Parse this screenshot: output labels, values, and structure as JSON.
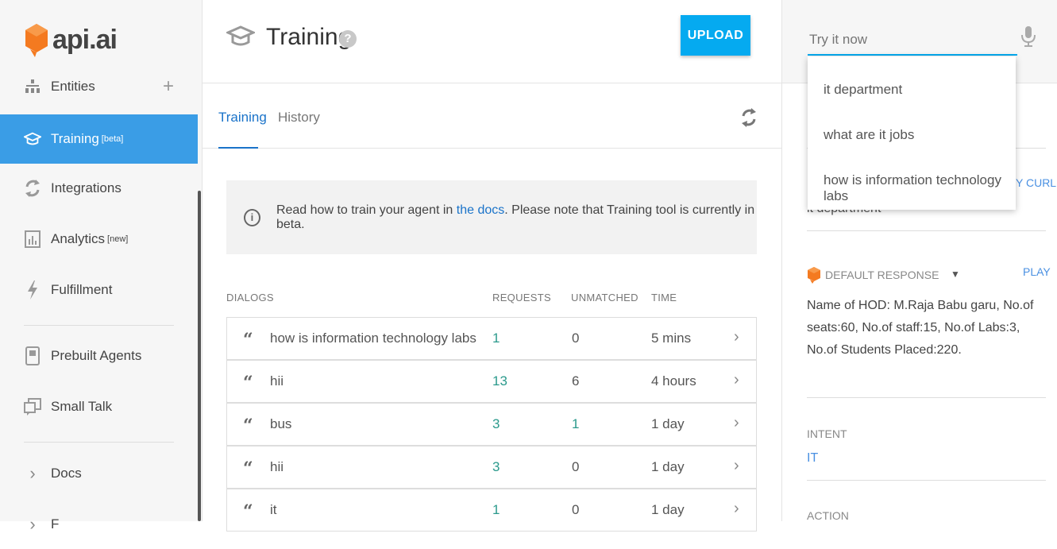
{
  "brand": {
    "name": "api.ai",
    "color": "#f47a20"
  },
  "sidebar": {
    "items": [
      {
        "label": "Entities",
        "icon": "entities-icon"
      },
      {
        "label": "Training",
        "sup": "[beta]",
        "icon": "graduation-cap-icon"
      },
      {
        "label": "Integrations",
        "icon": "integrations-icon"
      },
      {
        "label": "Analytics",
        "sup": "[new]",
        "icon": "analytics-icon"
      },
      {
        "label": "Fulfillment",
        "icon": "lightning-icon"
      },
      {
        "label": "Prebuilt Agents",
        "icon": "book-icon"
      },
      {
        "label": "Small Talk",
        "icon": "chat-icon"
      },
      {
        "label": "Docs",
        "icon": "chevron-right-icon"
      },
      {
        "label": "F",
        "icon": "chevron-right-icon"
      }
    ],
    "plus": "+",
    "active_color": "#3a9de6"
  },
  "header": {
    "title": "Training",
    "help": "?",
    "upload_label": "UPLOAD"
  },
  "tabs": [
    {
      "label": "Training"
    },
    {
      "label": "History"
    }
  ],
  "info": {
    "prefix": "Read how to train your agent in ",
    "link": "the docs",
    "suffix": ". Please note that Training tool is currently in beta."
  },
  "table": {
    "columns": [
      "DIALOGS",
      "REQUESTS",
      "UNMATCHED",
      "TIME"
    ],
    "rows": [
      {
        "dialog": "how is information technology labs",
        "requests": "1",
        "unmatched": "0",
        "time": "5 mins"
      },
      {
        "dialog": "hii",
        "requests": "13",
        "unmatched": "6",
        "time": "4 hours"
      },
      {
        "dialog": "bus",
        "requests": "3",
        "unmatched": "1",
        "time": "1 day"
      },
      {
        "dialog": "hii",
        "requests": "3",
        "unmatched": "0",
        "time": "1 day"
      },
      {
        "dialog": "it",
        "requests": "1",
        "unmatched": "0",
        "time": "1 day"
      }
    ]
  },
  "try_it": {
    "placeholder": "Try it now",
    "suggestions": [
      "it department",
      "what are it jobs",
      "how is information technology labs"
    ]
  },
  "right_panel": {
    "user_says_partial": "it department",
    "curl_label": "Y CURL",
    "default_response_label": "DEFAULT RESPONSE",
    "play_label": "PLAY",
    "response_text": "Name of HOD: M.Raja Babu garu, No.of seats:60, No.of staff:15, No.of Labs:3, No.of Students Placed:220.",
    "intent_label": "INTENT",
    "intent_value": "IT",
    "action_label": "ACTION"
  }
}
